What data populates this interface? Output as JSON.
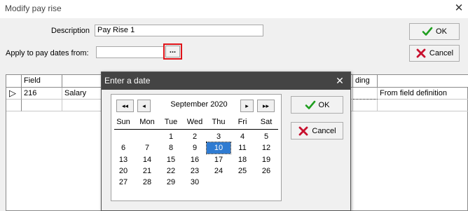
{
  "window": {
    "title": "Modify pay rise",
    "close_glyph": "✕"
  },
  "form": {
    "description_label": "Description",
    "description_value": "Pay Rise 1",
    "apply_label": "Apply to pay dates from:",
    "apply_value": "",
    "ellipsis_label": "..."
  },
  "buttons": {
    "ok": "OK",
    "cancel": "Cancel"
  },
  "grid": {
    "columns": [
      "Field",
      "",
      "",
      "",
      "ding",
      ""
    ],
    "rows": [
      {
        "indicator": "▷",
        "field": "216",
        "name": "Salary",
        "source": "From field definition"
      }
    ]
  },
  "dialog": {
    "title": "Enter a date",
    "close_glyph": "✕",
    "ok": "OK",
    "cancel": "Cancel",
    "nav": {
      "prev_year": "◂◂",
      "prev_month": "◂",
      "next_month": "▸",
      "next_year": "▸▸"
    },
    "month_label": "September  2020",
    "day_headers": [
      "Sun",
      "Mon",
      "Tue",
      "Wed",
      "Thu",
      "Fri",
      "Sat"
    ],
    "weeks": [
      [
        "",
        "",
        "1",
        "2",
        "3",
        "4",
        "5"
      ],
      [
        "6",
        "7",
        "8",
        "9",
        "10",
        "11",
        "12"
      ],
      [
        "13",
        "14",
        "15",
        "16",
        "17",
        "18",
        "19"
      ],
      [
        "20",
        "21",
        "22",
        "23",
        "24",
        "25",
        "26"
      ],
      [
        "27",
        "28",
        "29",
        "30",
        "",
        "",
        ""
      ]
    ],
    "selected_day": "10"
  },
  "colors": {
    "selected": "#2f7bd1",
    "dialog_title_bg": "#444444",
    "highlight": "#e0141a",
    "check": "#1f9e1f",
    "cross": "#c8102e"
  }
}
